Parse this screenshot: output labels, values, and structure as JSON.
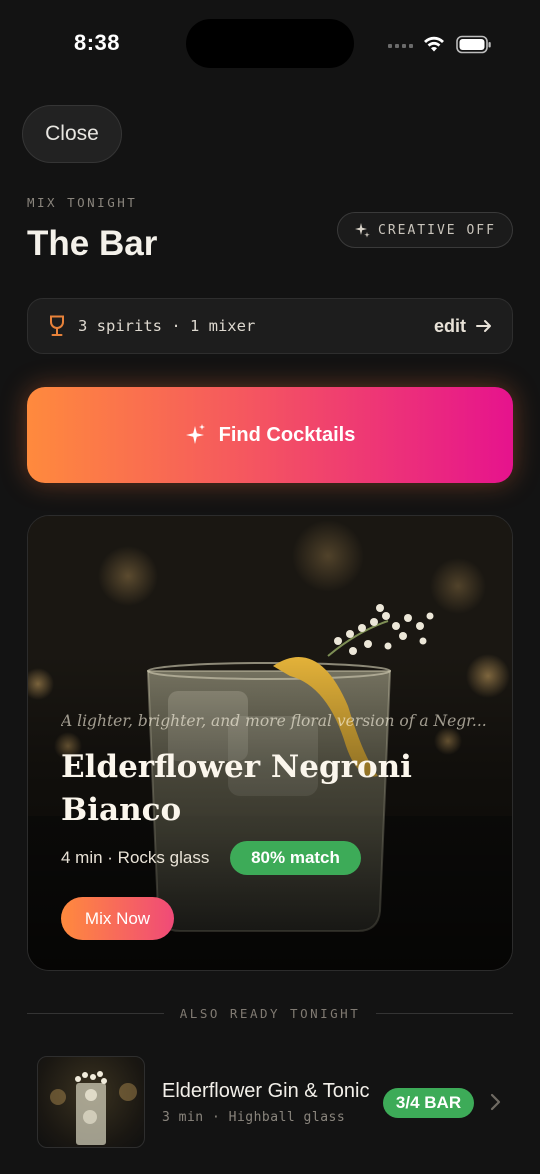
{
  "status_bar": {
    "time": "8:38"
  },
  "header": {
    "close_label": "Close",
    "eyebrow": "MIX TONIGHT",
    "title": "The Bar",
    "creative_label": "CREATIVE OFF"
  },
  "inventory": {
    "summary": "3 spirits · 1 mixer",
    "edit_label": "edit",
    "icon": "wine-glass-icon"
  },
  "find_button": {
    "label": "Find Cocktails",
    "icon": "sparkle-icon"
  },
  "featured": {
    "description": "A lighter, brighter, and more floral version of a Negr...",
    "name": "Elderflower Negroni Bianco",
    "meta": "4 min · Rocks glass",
    "match": "80% match",
    "cta": "Mix Now"
  },
  "section": {
    "label": "ALSO READY TONIGHT"
  },
  "list": [
    {
      "name": "Elderflower Gin & Tonic",
      "meta": "3 min · Highball glass",
      "badge": "3/4 BAR"
    }
  ],
  "colors": {
    "background": "#131313",
    "gradient_start": "#ff8a3d",
    "gradient_end": "#e6138d",
    "match_green": "#3dab58"
  }
}
